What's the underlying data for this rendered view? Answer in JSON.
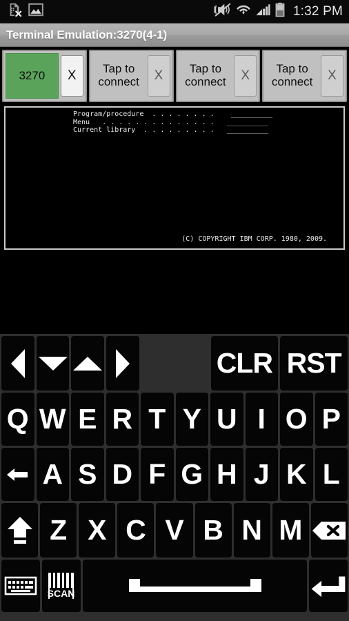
{
  "statusbar": {
    "icons_left": [
      "sim-card-error-icon",
      "image-icon"
    ],
    "icons_right": [
      "mute-vibrate-icon",
      "wifi-icon",
      "signal-bars-icon",
      "battery-icon"
    ],
    "time": "1:32 PM"
  },
  "titlebar": {
    "title": "Terminal Emulation:3270(4-1)"
  },
  "tabs": [
    {
      "label": "3270",
      "close_label": "X",
      "active": true
    },
    {
      "label": "Tap to connect",
      "close_label": "X",
      "active": false
    },
    {
      "label": "Tap to connect",
      "close_label": "X",
      "active": false
    },
    {
      "label": "Tap to connect",
      "close_label": "X",
      "active": false
    }
  ],
  "terminal": {
    "lines": "Program/procedure  . . . . . . . .    __________\nMenu   . . . . . . . . . . . . . .   __________\nCurrent library  . . . . . . . . .   __________",
    "copyright": "(C) COPYRIGHT IBM CORP. 1980, 2009."
  },
  "keyboard": {
    "row1": [
      {
        "name": "arrow-left-key",
        "glyph": "left",
        "label": ""
      },
      {
        "name": "arrow-down-key",
        "glyph": "down",
        "label": ""
      },
      {
        "name": "arrow-up-key",
        "glyph": "up",
        "label": ""
      },
      {
        "name": "arrow-right-key",
        "glyph": "right",
        "label": ""
      },
      {
        "name": "keyboard-spacer",
        "glyph": "",
        "label": ""
      },
      {
        "name": "clr-key",
        "glyph": "",
        "label": "CLR"
      },
      {
        "name": "rst-key",
        "glyph": "",
        "label": "RST"
      }
    ],
    "row2": [
      "Q",
      "W",
      "E",
      "R",
      "T",
      "Y",
      "U",
      "I",
      "O",
      "P"
    ],
    "row3_tab": "tab-key",
    "row3": [
      "A",
      "S",
      "D",
      "F",
      "G",
      "H",
      "J",
      "K",
      "L"
    ],
    "row4_shift": "shift-key",
    "row4": [
      "Z",
      "X",
      "C",
      "V",
      "B",
      "N",
      "M"
    ],
    "row4_backspace": "backspace-key",
    "row5": [
      {
        "name": "show-keyboard-key",
        "label": ""
      },
      {
        "name": "scan-key",
        "label": "SCAN"
      },
      {
        "name": "space-key",
        "label": ""
      },
      {
        "name": "enter-key",
        "label": ""
      }
    ]
  },
  "colors": {
    "accent_green": "#5aa35a",
    "titlebar_gray": "#a8a8a8",
    "key_black": "#050505",
    "keyboard_bg": "#2e2e2e"
  }
}
